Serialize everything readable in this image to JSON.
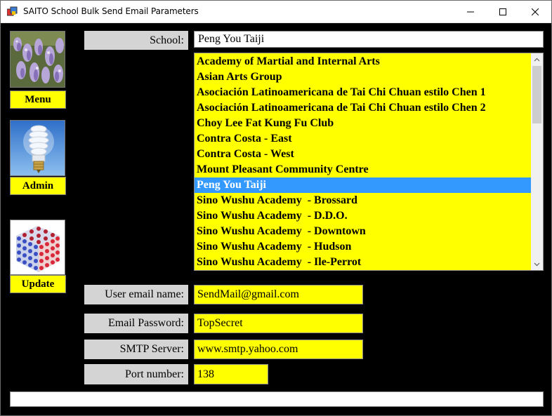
{
  "window": {
    "title": "SAITO School Bulk Send Email Parameters",
    "controls": {
      "minimize": "minimize",
      "maximize": "maximize",
      "close": "close"
    }
  },
  "sidebar": {
    "menu_label": "Menu",
    "admin_label": "Admin",
    "update_label": "Update"
  },
  "school": {
    "label": "School:",
    "value": "Peng You Taiji",
    "list": [
      "Academy of Martial and Internal Arts",
      "Asian Arts Group",
      "Asociación Latinoamericana de Tai Chi Chuan estilo Chen 1",
      "Asociación Latinoamericana de Tai Chi Chuan estilo Chen 2",
      "Choy Lee Fat Kung Fu Club",
      "Contra Costa - East",
      "Contra Costa - West",
      "Mount Pleasant Community Centre",
      "Peng You Taiji",
      "Sino Wushu Academy  - Brossard",
      "Sino Wushu Academy  - D.D.O.",
      "Sino Wushu Academy  - Downtown",
      "Sino Wushu Academy  - Hudson",
      "Sino Wushu Academy  - Ile-Perrot"
    ],
    "selected_index": 8
  },
  "email": {
    "user_label": "User email name:",
    "user_value": "SendMail@gmail.com",
    "password_label": "Email Password:",
    "password_value": "TopSecret",
    "smtp_label": "SMTP Server:",
    "smtp_value": "www.smtp.yahoo.com",
    "port_label": "Port number:",
    "port_value": "138"
  },
  "status": {
    "text": ""
  },
  "colors": {
    "field_bg": "#ffff00",
    "label_bg": "#d4d4d4",
    "selection": "#3399ff",
    "background": "#000000"
  }
}
